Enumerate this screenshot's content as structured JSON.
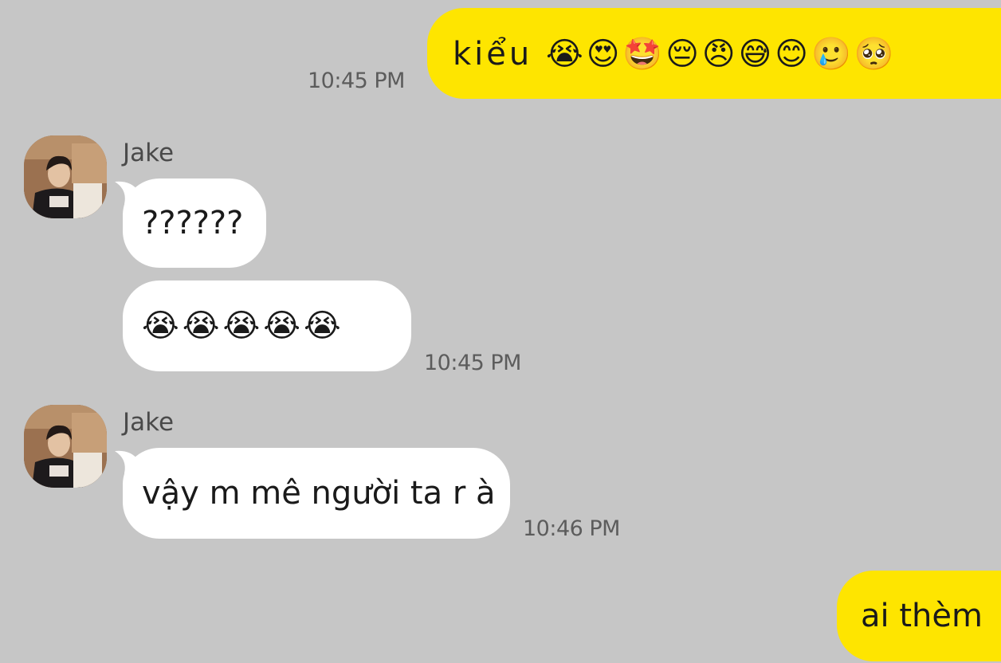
{
  "messages": [
    {
      "direction": "out",
      "text": "kiểu 😭😍🤩😔😠😅😊🥲🥺",
      "time": "10:45 PM"
    },
    {
      "direction": "in",
      "sender": "Jake",
      "lines": [
        "??????",
        "😭😭😭😭😭"
      ],
      "time": "10:45 PM"
    },
    {
      "direction": "in",
      "sender": "Jake",
      "text": "vậy m mê người ta r à",
      "time": "10:46 PM"
    },
    {
      "direction": "out",
      "text": "ai thèm"
    }
  ],
  "colors": {
    "background": "#c6c6c6",
    "outgoing_bubble": "#fee500",
    "incoming_bubble": "#ffffff"
  },
  "icons": {
    "avatar": "profile-photo"
  }
}
